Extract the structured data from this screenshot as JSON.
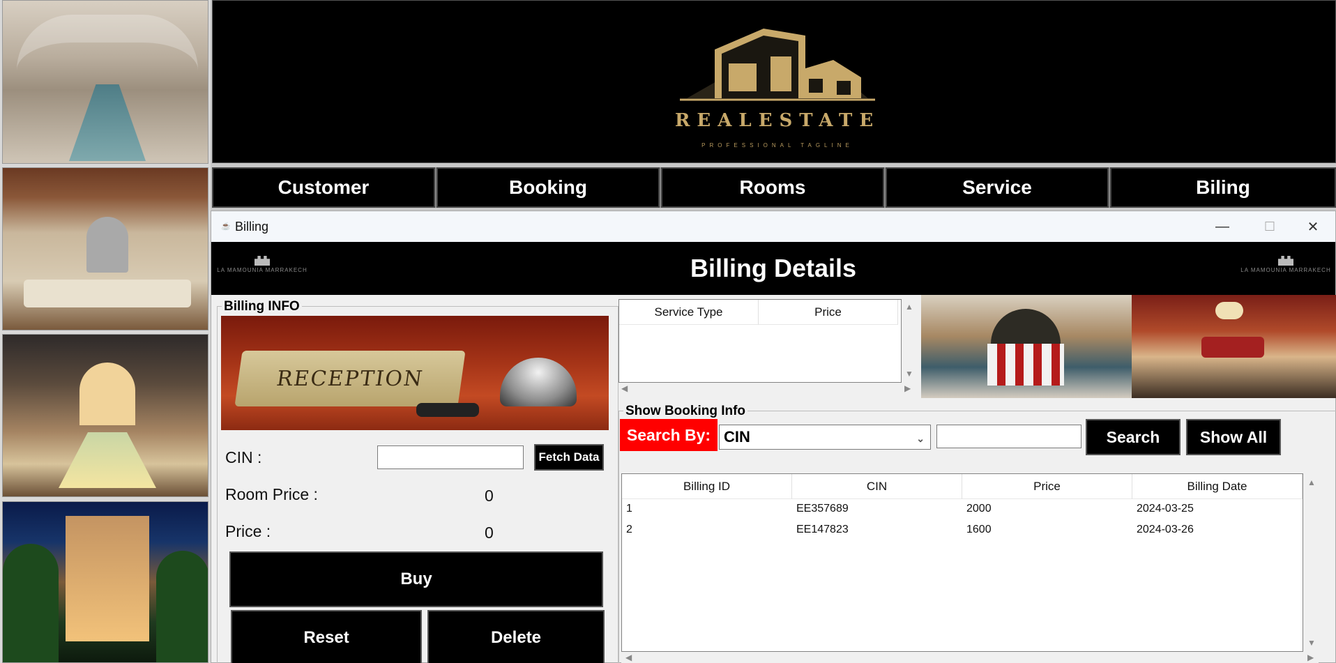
{
  "banner": {
    "logo_text": "REALESTATE",
    "logo_tagline": "PROFESSIONAL TAGLINE"
  },
  "nav": [
    "Customer",
    "Booking",
    "Rooms",
    "Service",
    "Biling"
  ],
  "window": {
    "title": "Billing",
    "minimize": "—",
    "maximize": "☐",
    "close": "✕"
  },
  "header": {
    "title": "Billing Details",
    "logo_text": "LA MAMOUNIA MARRAKECH"
  },
  "billing_info": {
    "group_label": "Billing INFO",
    "reception_sign": "RECEPTION",
    "cin_label": "CIN :",
    "cin_value": "",
    "fetch_button": "Fetch Data",
    "room_price_label": "Room Price :",
    "room_price_value": "0",
    "price_label": "Price :",
    "price_value": "0",
    "buy_button": "Buy",
    "reset_button": "Reset",
    "delete_button": "Delete"
  },
  "service_table": {
    "columns": [
      "Service Type",
      "Price"
    ],
    "rows": []
  },
  "booking_info": {
    "group_label": "Show Booking Info",
    "search_by_label": "Search By:",
    "search_by_selected": "CIN",
    "search_value": "",
    "search_button": "Search",
    "show_all_button": "Show All",
    "columns": [
      "Billing ID",
      "CIN",
      "Price",
      "Billing Date"
    ],
    "rows": [
      [
        "1",
        "EE357689",
        "2000",
        "2024-03-25"
      ],
      [
        "2",
        "EE147823",
        "1600",
        "2024-03-26"
      ]
    ]
  },
  "colors": {
    "accent_red": "#ff0000",
    "black": "#000000",
    "gold": "#c8a96a"
  },
  "icons": [
    "java-icon",
    "chevron-down-icon",
    "minimize-icon",
    "maximize-icon",
    "close-icon"
  ]
}
